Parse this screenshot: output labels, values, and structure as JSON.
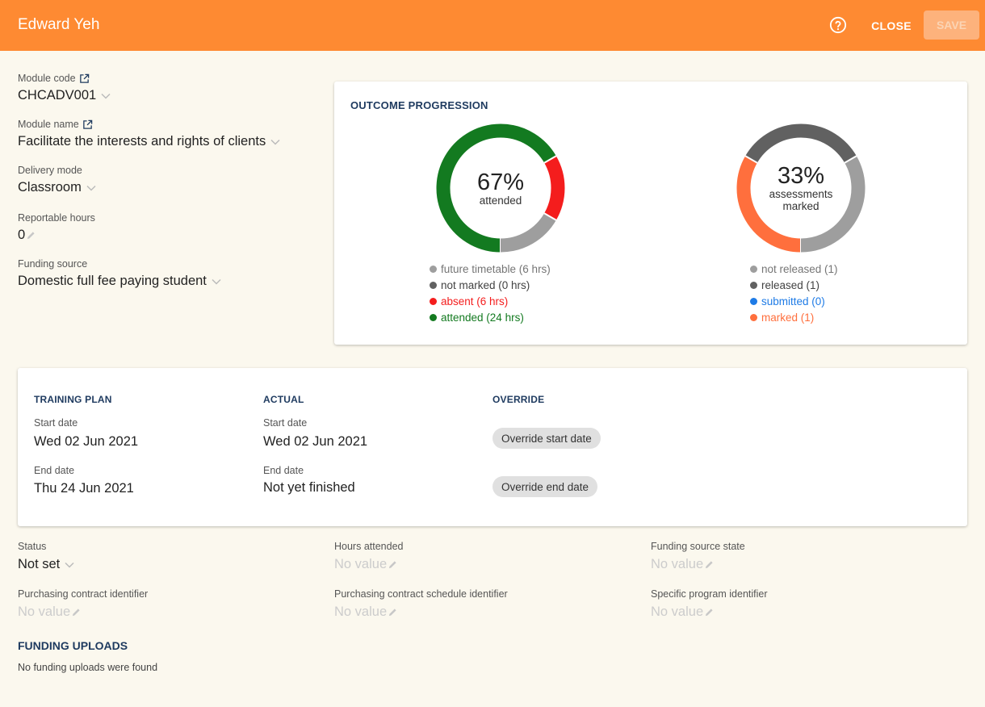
{
  "header": {
    "title": "Edward Yeh",
    "help_icon": "help-circle-icon",
    "close_label": "CLOSE",
    "save_label": "SAVE"
  },
  "module": {
    "code_label": "Module code",
    "code_value": "CHCADV001",
    "name_label": "Module name",
    "name_value": "Facilitate the interests and rights of clients",
    "delivery_label": "Delivery mode",
    "delivery_value": "Classroom",
    "hours_label": "Reportable hours",
    "hours_value": "0",
    "funding_label": "Funding source",
    "funding_value": "Domestic full fee paying student"
  },
  "outcome": {
    "title": "OUTCOME PROGRESSION",
    "attendance": {
      "percent": "67%",
      "caption": "attended",
      "legend": [
        {
          "label": "future timetable (6 hrs)",
          "color": "#9e9e9e",
          "text_color": "#757575"
        },
        {
          "label": "not marked (0 hrs)",
          "color": "#616161",
          "text_color": "#424242"
        },
        {
          "label": "absent (6 hrs)",
          "color": "#f41d1d",
          "text_color": "#f41d1d"
        },
        {
          "label": "attended (24 hrs)",
          "color": "#137a20",
          "text_color": "#137a20"
        }
      ],
      "segments": [
        {
          "name": "attended",
          "value": 24,
          "color": "#137a20"
        },
        {
          "name": "absent",
          "value": 6,
          "color": "#f41d1d"
        },
        {
          "name": "future timetable",
          "value": 6,
          "color": "#9e9e9e"
        }
      ]
    },
    "assessments": {
      "percent": "33%",
      "caption_line1": "assessments",
      "caption_line2": "marked",
      "legend": [
        {
          "label": "not released (1)",
          "color": "#9e9e9e",
          "text_color": "#757575"
        },
        {
          "label": "released (1)",
          "color": "#616161",
          "text_color": "#424242"
        },
        {
          "label": "submitted (0)",
          "color": "#1e7be6",
          "text_color": "#1e7be6"
        },
        {
          "label": "marked (1)",
          "color": "#ff6f3d",
          "text_color": "#ff6f3d"
        }
      ],
      "segments": [
        {
          "name": "marked",
          "value": 1,
          "color": "#ff6f3d"
        },
        {
          "name": "released",
          "value": 1,
          "color": "#616161"
        },
        {
          "name": "not released",
          "value": 1,
          "color": "#9e9e9e"
        }
      ]
    }
  },
  "dates": {
    "plan_head": "TRAINING PLAN",
    "actual_head": "ACTUAL",
    "override_head": "OVERRIDE",
    "start_label": "Start date",
    "end_label": "End date",
    "plan_start": "Wed 02 Jun 2021",
    "plan_end": "Thu 24 Jun 2021",
    "actual_start": "Wed 02 Jun 2021",
    "actual_end": "Not yet finished",
    "override_start": "Override start date",
    "override_end": "Override end date"
  },
  "details": {
    "status_label": "Status",
    "status_value": "Not set",
    "hours_attended_label": "Hours attended",
    "funding_state_label": "Funding source state",
    "pc_label": "Purchasing contract identifier",
    "pcs_label": "Purchasing contract schedule identifier",
    "sp_label": "Specific program identifier",
    "no_value": "No value"
  },
  "uploads": {
    "title": "FUNDING UPLOADS",
    "empty": "No funding uploads were found"
  }
}
